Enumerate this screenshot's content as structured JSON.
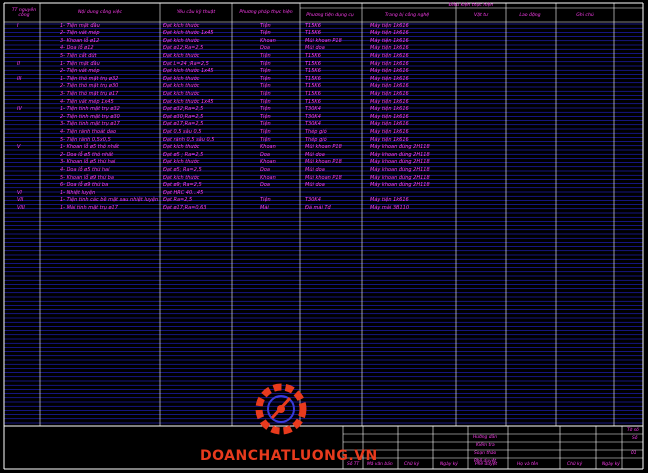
{
  "header": {
    "col_tt": "TT nguyên công",
    "col_content": "Nội dung công việc",
    "col_req": "Yêu cầu kỹ thuật",
    "col_method": "Phương pháp thực hiện",
    "group_cond": "Điều kiện thực hiện",
    "col_equip": "Phương tiện dụng cụ",
    "col_machine": "Trang bị công nghệ",
    "col_material": "Vật tư",
    "col_labor": "Lao động",
    "col_note": "Ghi chú"
  },
  "rows": [
    {
      "no": "I",
      "content": "1- Tiện mặt đầu",
      "req": "Đạt kích thước",
      "method": "Tiện",
      "equip": "T15K6",
      "machine": "Máy tiện 1k616"
    },
    {
      "no": "",
      "content": "2- Tiện vát mép",
      "req": "Đạt kích thước 1x45",
      "method": "Tiện",
      "equip": "T15K6",
      "machine": "Máy tiện 1k616"
    },
    {
      "no": "",
      "content": "3- Khoan lỗ ø12",
      "req": "Đạt kích thước",
      "method": "Khoan",
      "equip": "Mũi khoan P18",
      "machine": "Máy tiện 1k616"
    },
    {
      "no": "",
      "content": "4- Doa lỗ ø12",
      "req": "Đạt ø12;Ra=2,5",
      "method": "Doa",
      "equip": "Mũi doa",
      "machine": "Máy tiện 1k616"
    },
    {
      "no": "",
      "content": "5- Tiện cắt đứt",
      "req": "Đạt kích thước",
      "method": "Tiện",
      "equip": "T15K6",
      "machine": "Máy tiện 1k616"
    },
    {
      "no": "II",
      "content": "1- Tiện mặt đầu",
      "req": "Đạt L=24 ;Ra=2,5",
      "method": "Tiện",
      "equip": "T15K6",
      "machine": "Máy tiện 1k616"
    },
    {
      "no": "",
      "content": "2- Tiện vát mép",
      "req": "Đạt kích thước 1x45",
      "method": "Tiện",
      "equip": "T15K6",
      "machine": "Máy tiện 1k616"
    },
    {
      "no": "III",
      "content": "1- Tiện thô mặt trụ ø32",
      "req": "Đạt kích thước",
      "method": "Tiện",
      "equip": "T15K6",
      "machine": "Máy tiện 1k616"
    },
    {
      "no": "",
      "content": "2- Tiện thô mặt trụ ø30",
      "req": "Đạt kích thước",
      "method": "Tiện",
      "equip": "T15K6",
      "machine": "Máy tiện 1k616"
    },
    {
      "no": "",
      "content": "3- Tiện thô mặt trụ ø17",
      "req": "Đạt kích thước",
      "method": "Tiện",
      "equip": "T15K6",
      "machine": "Máy tiện 1k616"
    },
    {
      "no": "",
      "content": "4- Tiện vát mép 1x45",
      "req": "Đạt kích thước 1x45",
      "method": "Tiện",
      "equip": "T15K6",
      "machine": "Máy tiện 1k616"
    },
    {
      "no": "IV",
      "content": "1- Tiện tinh mặt trụ ø32",
      "req": "Đạt ø32;Ra=2,5",
      "method": "Tiện",
      "equip": "T30K4",
      "machine": "Máy tiện 1k616"
    },
    {
      "no": "",
      "content": "2- Tiện tinh mặt trụ ø30",
      "req": "Đạt ø30;Ra=2,5",
      "method": "Tiện",
      "equip": "T30K4",
      "machine": "Máy tiện 1k616"
    },
    {
      "no": "",
      "content": "3- Tiện tinh mặt trụ ø17",
      "req": "Đạt ø17;Ra=2,5",
      "method": "Tiện",
      "equip": "T30K4",
      "machine": "Máy tiện 1k616"
    },
    {
      "no": "",
      "content": "4- Tiện rãnh thoát dao",
      "req": "Đạt 0,5 sâu 0,5",
      "method": "Tiện",
      "equip": "Thép gió",
      "machine": "Máy tiện 1k616"
    },
    {
      "no": "",
      "content": "5- Tiện rãnh 0,5x0,5",
      "req": "Đạt rãnh 0,5 sâu 0,5",
      "method": "Tiện",
      "equip": "Thép gió",
      "machine": "Máy tiện 1k616"
    },
    {
      "no": "V",
      "content": "1- Khoan lỗ ø5 thô nhất",
      "req": "Đạt kích thước",
      "method": "Khoan",
      "equip": "Mũi khoan P18",
      "machine": "Máy khoan đứng 2H118"
    },
    {
      "no": "",
      "content": "2- Doa lỗ ø5 thô nhất",
      "req": "Đạt ø5 ; Ra=2,5",
      "method": "Doa",
      "equip": "Mũi doa",
      "machine": "Máy khoan đứng 2H118"
    },
    {
      "no": "",
      "content": "3- Khoan lỗ ø5 thứ hai",
      "req": "Đạt kích thước",
      "method": "Khoan",
      "equip": "Mũi khoan P18",
      "machine": "Máy khoan đứng 2H118"
    },
    {
      "no": "",
      "content": "4- Doa lỗ ø5 thứ hai",
      "req": "Đạt ø5; Ra=2,5",
      "method": "Doa",
      "equip": "Mũi doa",
      "machine": "Máy khoan đứng 2H118"
    },
    {
      "no": "",
      "content": "5- Khoan lỗ ø9 thứ ba",
      "req": "Đạt kích thước",
      "method": "Khoan",
      "equip": "Mũi khoan P18",
      "machine": "Máy khoan đứng 2H118"
    },
    {
      "no": "",
      "content": "6- Doa lỗ ø9 thứ ba",
      "req": "Đạt ø9; Ra=2,5",
      "method": "Doa",
      "equip": "Mũi doa",
      "machine": "Máy khoan đứng 2H118"
    },
    {
      "no": "VI",
      "content": "1- Nhiệt luyện",
      "req": "Đạt HRC 40...45",
      "method": "",
      "equip": "",
      "machine": ""
    },
    {
      "no": "VII",
      "content": "1- Tiện tinh các bề mặt sau nhiệt luyện",
      "req": "Đạt Ra=2,5",
      "method": "Tiện",
      "equip": "T30K4",
      "machine": "Máy tiện 1k616"
    },
    {
      "no": "VIII",
      "content": "1- Mài tinh mặt trụ ø17",
      "req": "Đạt ø17;Ra=0,63",
      "method": "Mài",
      "equip": "Đá mài Tđ",
      "machine": "Máy mài 3B110"
    }
  ],
  "title_block": {
    "r1": "Tờ số",
    "r2": "Số",
    "r3": "01",
    "l1": "Hướng dẫn",
    "l2": "Kiểm tra",
    "l3": "Soạn thảo",
    "l4": "Phê duyệt",
    "f1": "Số TT",
    "f2": "Mã văn bản",
    "f3": "Chữ ký",
    "f4": "Ngày ký",
    "f5": "Phê duyệt",
    "f6": "Họ và tên",
    "f7": "Chữ ký",
    "f8": "Ngày ký"
  },
  "watermark": "DOANCHATLUONG.VN",
  "colors": {
    "background": "#000000",
    "lines": "#2a2aff",
    "text": "#ff3df0",
    "frame": "#ffffff",
    "brand": "#e83a1d"
  }
}
